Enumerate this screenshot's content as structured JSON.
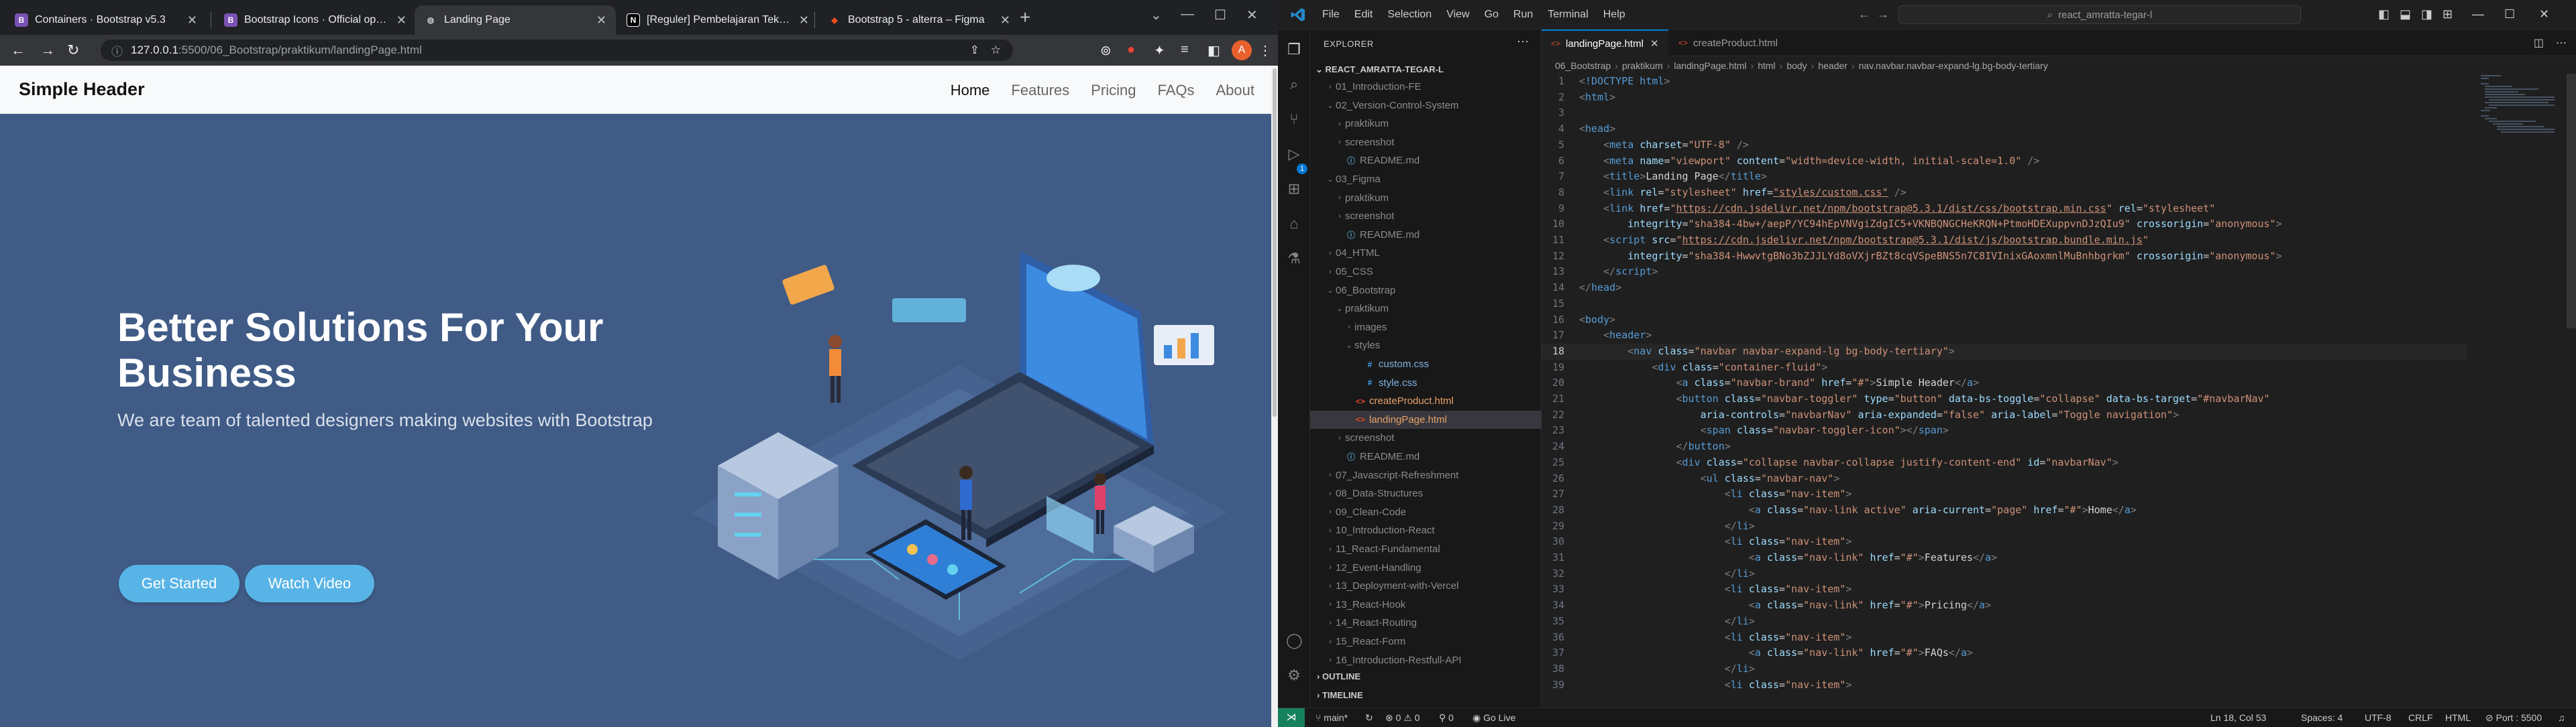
{
  "browser": {
    "tabs": [
      {
        "label": "Containers · Bootstrap v5.3",
        "favicon": "B",
        "favicon_color": "#7952b3",
        "active": false
      },
      {
        "label": "Bootstrap Icons · Official open so",
        "favicon": "B",
        "favicon_color": "#7952b3",
        "active": false
      },
      {
        "label": "Landing Page",
        "favicon": "globe-icon",
        "favicon_color": "#bdc1c6",
        "active": true
      },
      {
        "label": "[Reguler] Pembelajaran Teknis Re",
        "favicon": "N",
        "favicon_color": "#ffffff",
        "active": false
      },
      {
        "label": "Bootstrap 5 - alterra – Figma",
        "favicon": "figma-icon",
        "favicon_color": "#f24e1e",
        "active": false
      }
    ],
    "address": {
      "host": "127.0.0.1",
      "path": ":5500/06_Bootstrap/praktikum/landingPage.html"
    },
    "profile_initial": "A"
  },
  "website": {
    "brand": "Simple Header",
    "nav": [
      "Home",
      "Features",
      "Pricing",
      "FAQs",
      "About"
    ],
    "hero_title": "Better Solutions For Your Business",
    "hero_subtitle": "We are team of talented designers making websites with Bootstrap",
    "buttons": {
      "primary": "Get Started",
      "secondary": "Watch Video"
    },
    "colors": {
      "hero_bg": "#3f5b86",
      "button": "#58b4e6"
    }
  },
  "vscode": {
    "menu": [
      "File",
      "Edit",
      "Selection",
      "View",
      "Go",
      "Run",
      "Terminal",
      "Help"
    ],
    "search": "react_amratta-tegar-l",
    "explorer": {
      "title": "EXPLORER",
      "root": "REACT_AMRATTA-TEGAR-L",
      "tree": [
        {
          "label": "01_Introduction-FE",
          "indent": 1,
          "kind": "folder-closed"
        },
        {
          "label": "02_Version-Control-System",
          "indent": 1,
          "kind": "folder-open"
        },
        {
          "label": "praktikum",
          "indent": 2,
          "kind": "folder-closed"
        },
        {
          "label": "screenshot",
          "indent": 2,
          "kind": "folder-closed"
        },
        {
          "label": "README.md",
          "indent": 2,
          "kind": "md"
        },
        {
          "label": "03_Figma",
          "indent": 1,
          "kind": "folder-open"
        },
        {
          "label": "praktikum",
          "indent": 2,
          "kind": "folder-closed"
        },
        {
          "label": "screenshot",
          "indent": 2,
          "kind": "folder-closed"
        },
        {
          "label": "README.md",
          "indent": 2,
          "kind": "md"
        },
        {
          "label": "04_HTML",
          "indent": 1,
          "kind": "folder-closed"
        },
        {
          "label": "05_CSS",
          "indent": 1,
          "kind": "folder-closed"
        },
        {
          "label": "06_Bootstrap",
          "indent": 1,
          "kind": "folder-open"
        },
        {
          "label": "praktikum",
          "indent": 2,
          "kind": "folder-open"
        },
        {
          "label": "images",
          "indent": 3,
          "kind": "folder-closed"
        },
        {
          "label": "styles",
          "indent": 3,
          "kind": "folder-open"
        },
        {
          "label": "custom.css",
          "indent": 4,
          "kind": "css"
        },
        {
          "label": "style.css",
          "indent": 4,
          "kind": "css"
        },
        {
          "label": "createProduct.html",
          "indent": 3,
          "kind": "html"
        },
        {
          "label": "landingPage.html",
          "indent": 3,
          "kind": "html",
          "selected": true
        },
        {
          "label": "screenshot",
          "indent": 2,
          "kind": "folder-closed"
        },
        {
          "label": "README.md",
          "indent": 2,
          "kind": "md"
        },
        {
          "label": "07_Javascript-Refreshment",
          "indent": 1,
          "kind": "folder-closed"
        },
        {
          "label": "08_Data-Structures",
          "indent": 1,
          "kind": "folder-closed"
        },
        {
          "label": "09_Clean-Code",
          "indent": 1,
          "kind": "folder-closed"
        },
        {
          "label": "10_Introduction-React",
          "indent": 1,
          "kind": "folder-closed"
        },
        {
          "label": "11_React-Fundamental",
          "indent": 1,
          "kind": "folder-closed"
        },
        {
          "label": "12_Event-Handling",
          "indent": 1,
          "kind": "folder-closed"
        },
        {
          "label": "13_Deployment-with-Vercel",
          "indent": 1,
          "kind": "folder-closed"
        },
        {
          "label": "13_React-Hook",
          "indent": 1,
          "kind": "folder-closed"
        },
        {
          "label": "14_React-Routing",
          "indent": 1,
          "kind": "folder-closed"
        },
        {
          "label": "15_React-Form",
          "indent": 1,
          "kind": "folder-closed"
        },
        {
          "label": "16_Introduction-Restfull-API",
          "indent": 1,
          "kind": "folder-closed"
        }
      ],
      "outline": "OUTLINE",
      "timeline": "TIMELINE"
    },
    "editor_tabs": [
      {
        "label": "landingPage.html",
        "active": true
      },
      {
        "label": "createProduct.html",
        "active": false
      }
    ],
    "breadcrumbs": [
      "06_Bootstrap",
      "praktikum",
      "landingPage.html",
      "html",
      "body",
      "header",
      "nav.navbar.navbar-expand-lg.bg-body-tertiary"
    ],
    "current_line": 18,
    "code_lines": [
      {
        "n": "1",
        "html": "<span class='t-pun'>&lt;</span><span class='t-tag'>!DOCTYPE html</span><span class='t-pun'>&gt;</span>"
      },
      {
        "n": "2",
        "html": "<span class='t-pun'>&lt;</span><span class='t-tag'>html</span><span class='t-pun'>&gt;</span>"
      },
      {
        "n": "3",
        "html": ""
      },
      {
        "n": "4",
        "html": "<span class='t-pun'>&lt;</span><span class='t-tag'>head</span><span class='t-pun'>&gt;</span>"
      },
      {
        "n": "5",
        "html": "    <span class='t-pun'>&lt;</span><span class='t-tag'>meta</span> <span class='t-attr'>charset</span>=<span class='t-str'>\"UTF-8\"</span> <span class='t-pun'>/&gt;</span>"
      },
      {
        "n": "6",
        "html": "    <span class='t-pun'>&lt;</span><span class='t-tag'>meta</span> <span class='t-attr'>name</span>=<span class='t-str'>\"viewport\"</span> <span class='t-attr'>content</span>=<span class='t-str'>\"width=device-width, initial-scale=1.0\"</span> <span class='t-pun'>/&gt;</span>"
      },
      {
        "n": "7",
        "html": "    <span class='t-pun'>&lt;</span><span class='t-tag'>title</span><span class='t-pun'>&gt;</span><span class='t-txt'>Landing Page</span><span class='t-pun'>&lt;/</span><span class='t-tag'>title</span><span class='t-pun'>&gt;</span>"
      },
      {
        "n": "8",
        "html": "    <span class='t-pun'>&lt;</span><span class='t-tag'>link</span> <span class='t-attr'>rel</span>=<span class='t-str'>\"stylesheet\"</span> <span class='t-attr'>href</span>=<span class='t-url'>\"styles/custom.css\"</span> <span class='t-pun'>/&gt;</span>"
      },
      {
        "n": "9",
        "html": "    <span class='t-pun'>&lt;</span><span class='t-tag'>link</span> <span class='t-attr'>href</span>=<span class='t-str'>\"<u>https://cdn.jsdelivr.net/npm/bootstrap@5.3.1/dist/css/bootstrap.min.css</u>\"</span> <span class='t-attr'>rel</span>=<span class='t-str'>\"stylesheet\"</span>"
      },
      {
        "n": "10",
        "html": "        <span class='t-attr'>integrity</span>=<span class='t-str'>\"sha384-4bw+/aepP/YC94hEpVNVgiZdgIC5+VKNBQNGCHeKRQN+PtmoHDEXuppvnDJzQIu9\"</span> <span class='t-attr'>crossorigin</span>=<span class='t-str'>\"anonymous\"</span><span class='t-pun'>&gt;</span>"
      },
      {
        "n": "11",
        "html": "    <span class='t-pun'>&lt;</span><span class='t-tag'>script</span> <span class='t-attr'>src</span>=<span class='t-str'>\"<u>https://cdn.jsdelivr.net/npm/bootstrap@5.3.1/dist/js/bootstrap.bundle.min.js</u>\"</span>"
      },
      {
        "n": "12",
        "html": "        <span class='t-attr'>integrity</span>=<span class='t-str'>\"sha384-HwwvtgBNo3bZJJLYd8oVXjrBZt8cqVSpeBNS5n7C8IVInixGAoxmnlMuBnhbgrkm\"</span> <span class='t-attr'>crossorigin</span>=<span class='t-str'>\"anonymous\"</span><span class='t-pun'>&gt;</span>"
      },
      {
        "n": "13",
        "html": "    <span class='t-pun'>&lt;/</span><span class='t-tag'>script</span><span class='t-pun'>&gt;</span>"
      },
      {
        "n": "14",
        "html": "<span class='t-pun'>&lt;/</span><span class='t-tag'>head</span><span class='t-pun'>&gt;</span>"
      },
      {
        "n": "15",
        "html": ""
      },
      {
        "n": "16",
        "html": "<span class='t-pun'>&lt;</span><span class='t-tag'>body</span><span class='t-pun'>&gt;</span>"
      },
      {
        "n": "17",
        "html": "    <span class='t-pun'>&lt;</span><span class='t-tag'>header</span><span class='t-pun'>&gt;</span>"
      },
      {
        "n": "18",
        "html": "        <span class='t-pun'>&lt;</span><span class='t-tag'>nav</span> <span class='t-attr'>class</span>=<span class='t-str'>\"navbar navbar-expand-lg bg-body-tertiary\"</span><span class='t-pun'>&gt;</span>"
      },
      {
        "n": "19",
        "html": "            <span class='t-pun'>&lt;</span><span class='t-tag'>div</span> <span class='t-attr'>class</span>=<span class='t-str'>\"container-fluid\"</span><span class='t-pun'>&gt;</span>"
      },
      {
        "n": "20",
        "html": "                <span class='t-pun'>&lt;</span><span class='t-tag'>a</span> <span class='t-attr'>class</span>=<span class='t-str'>\"navbar-brand\"</span> <span class='t-attr'>href</span>=<span class='t-str'>\"#\"</span><span class='t-pun'>&gt;</span><span class='t-txt'>Simple Header</span><span class='t-pun'>&lt;/</span><span class='t-tag'>a</span><span class='t-pun'>&gt;</span>"
      },
      {
        "n": "21",
        "html": "                <span class='t-pun'>&lt;</span><span class='t-tag'>button</span> <span class='t-attr'>class</span>=<span class='t-str'>\"navbar-toggler\"</span> <span class='t-attr'>type</span>=<span class='t-str'>\"button\"</span> <span class='t-attr'>data-bs-toggle</span>=<span class='t-str'>\"collapse\"</span> <span class='t-attr'>data-bs-target</span>=<span class='t-str'>\"#navbarNav\"</span>"
      },
      {
        "n": "22",
        "html": "                    <span class='t-attr'>aria-controls</span>=<span class='t-str'>\"navbarNav\"</span> <span class='t-attr'>aria-expanded</span>=<span class='t-str'>\"false\"</span> <span class='t-attr'>aria-label</span>=<span class='t-str'>\"Toggle navigation\"</span><span class='t-pun'>&gt;</span>"
      },
      {
        "n": "23",
        "html": "                    <span class='t-pun'>&lt;</span><span class='t-tag'>span</span> <span class='t-attr'>class</span>=<span class='t-str'>\"navbar-toggler-icon\"</span><span class='t-pun'>&gt;&lt;/</span><span class='t-tag'>span</span><span class='t-pun'>&gt;</span>"
      },
      {
        "n": "24",
        "html": "                <span class='t-pun'>&lt;/</span><span class='t-tag'>button</span><span class='t-pun'>&gt;</span>"
      },
      {
        "n": "25",
        "html": "                <span class='t-pun'>&lt;</span><span class='t-tag'>div</span> <span class='t-attr'>class</span>=<span class='t-str'>\"collapse navbar-collapse justify-content-end\"</span> <span class='t-attr'>id</span>=<span class='t-str'>\"navbarNav\"</span><span class='t-pun'>&gt;</span>"
      },
      {
        "n": "26",
        "html": "                    <span class='t-pun'>&lt;</span><span class='t-tag'>ul</span> <span class='t-attr'>class</span>=<span class='t-str'>\"navbar-nav\"</span><span class='t-pun'>&gt;</span>"
      },
      {
        "n": "27",
        "html": "                        <span class='t-pun'>&lt;</span><span class='t-tag'>li</span> <span class='t-attr'>class</span>=<span class='t-str'>\"nav-item\"</span><span class='t-pun'>&gt;</span>"
      },
      {
        "n": "28",
        "html": "                            <span class='t-pun'>&lt;</span><span class='t-tag'>a</span> <span class='t-attr'>class</span>=<span class='t-str'>\"nav-link active\"</span> <span class='t-attr'>aria-current</span>=<span class='t-str'>\"page\"</span> <span class='t-attr'>href</span>=<span class='t-str'>\"#\"</span><span class='t-pun'>&gt;</span><span class='t-txt'>Home</span><span class='t-pun'>&lt;/</span><span class='t-tag'>a</span><span class='t-pun'>&gt;</span>"
      },
      {
        "n": "29",
        "html": "                        <span class='t-pun'>&lt;/</span><span class='t-tag'>li</span><span class='t-pun'>&gt;</span>"
      },
      {
        "n": "30",
        "html": "                        <span class='t-pun'>&lt;</span><span class='t-tag'>li</span> <span class='t-attr'>class</span>=<span class='t-str'>\"nav-item\"</span><span class='t-pun'>&gt;</span>"
      },
      {
        "n": "31",
        "html": "                            <span class='t-pun'>&lt;</span><span class='t-tag'>a</span> <span class='t-attr'>class</span>=<span class='t-str'>\"nav-link\"</span> <span class='t-attr'>href</span>=<span class='t-str'>\"#\"</span><span class='t-pun'>&gt;</span><span class='t-txt'>Features</span><span class='t-pun'>&lt;/</span><span class='t-tag'>a</span><span class='t-pun'>&gt;</span>"
      },
      {
        "n": "32",
        "html": "                        <span class='t-pun'>&lt;/</span><span class='t-tag'>li</span><span class='t-pun'>&gt;</span>"
      },
      {
        "n": "33",
        "html": "                        <span class='t-pun'>&lt;</span><span class='t-tag'>li</span> <span class='t-attr'>class</span>=<span class='t-str'>\"nav-item\"</span><span class='t-pun'>&gt;</span>"
      },
      {
        "n": "34",
        "html": "                            <span class='t-pun'>&lt;</span><span class='t-tag'>a</span> <span class='t-attr'>class</span>=<span class='t-str'>\"nav-link\"</span> <span class='t-attr'>href</span>=<span class='t-str'>\"#\"</span><span class='t-pun'>&gt;</span><span class='t-txt'>Pricing</span><span class='t-pun'>&lt;/</span><span class='t-tag'>a</span><span class='t-pun'>&gt;</span>"
      },
      {
        "n": "35",
        "html": "                        <span class='t-pun'>&lt;/</span><span class='t-tag'>li</span><span class='t-pun'>&gt;</span>"
      },
      {
        "n": "36",
        "html": "                        <span class='t-pun'>&lt;</span><span class='t-tag'>li</span> <span class='t-attr'>class</span>=<span class='t-str'>\"nav-item\"</span><span class='t-pun'>&gt;</span>"
      },
      {
        "n": "37",
        "html": "                            <span class='t-pun'>&lt;</span><span class='t-tag'>a</span> <span class='t-attr'>class</span>=<span class='t-str'>\"nav-link\"</span> <span class='t-attr'>href</span>=<span class='t-str'>\"#\"</span><span class='t-pun'>&gt;</span><span class='t-txt'>FAQs</span><span class='t-pun'>&lt;/</span><span class='t-tag'>a</span><span class='t-pun'>&gt;</span>"
      },
      {
        "n": "38",
        "html": "                        <span class='t-pun'>&lt;/</span><span class='t-tag'>li</span><span class='t-pun'>&gt;</span>"
      },
      {
        "n": "39",
        "html": "                        <span class='t-pun'>&lt;</span><span class='t-tag'>li</span> <span class='t-attr'>class</span>=<span class='t-str'>\"nav-item\"</span><span class='t-pun'>&gt;</span>"
      }
    ],
    "status": {
      "branch": "main*",
      "problems": "⊗ 0 ⚠ 0",
      "ports": "0",
      "live_server": "Go Live",
      "position": "Ln 18, Col 53",
      "spaces": "Spaces: 4",
      "encoding": "UTF-8",
      "eol": "CRLF",
      "language": "HTML",
      "port": "Port : 5500"
    }
  }
}
